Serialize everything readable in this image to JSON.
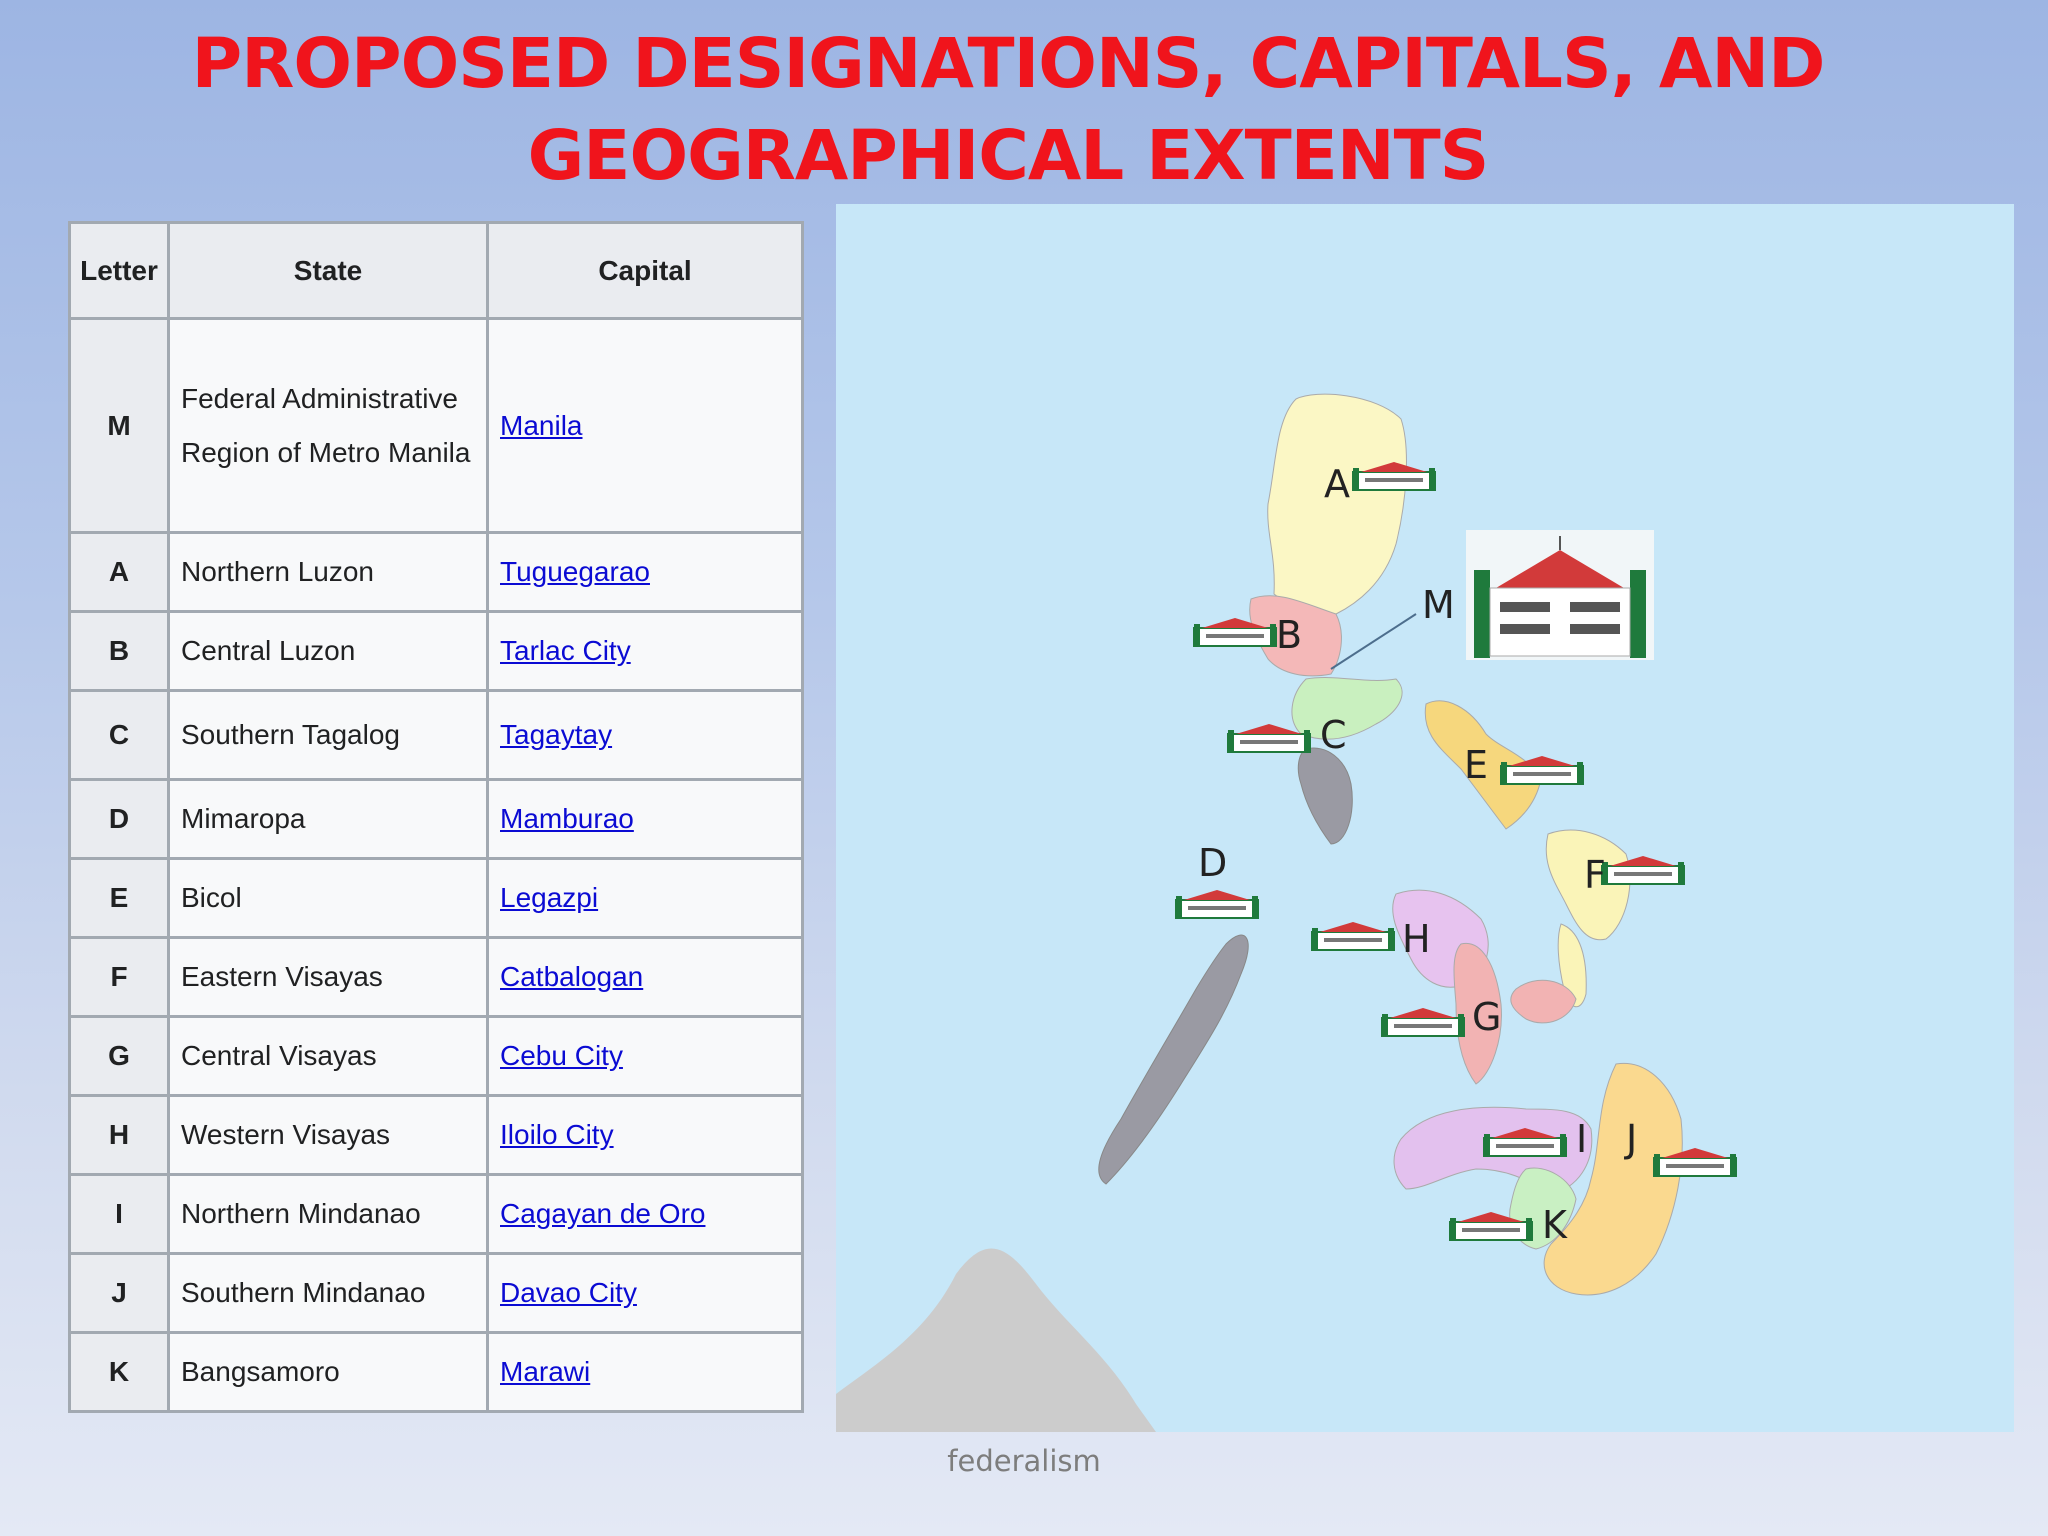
{
  "title": {
    "line1": "PROPOSED DESIGNATIONS, CAPITALS, AND",
    "line2": "GEOGRAPHICAL EXTENTS"
  },
  "table": {
    "headers": [
      "Letter",
      "State",
      "Capital"
    ],
    "rows": [
      {
        "letter": "M",
        "state": "Federal Administrative Region of Metro Manila",
        "capital": "Manila"
      },
      {
        "letter": "A",
        "state": "Northern Luzon",
        "capital": "Tuguegarao"
      },
      {
        "letter": "B",
        "state": "Central Luzon",
        "capital": "Tarlac City"
      },
      {
        "letter": "C",
        "state": "Southern Tagalog",
        "capital": "Tagaytay"
      },
      {
        "letter": "D",
        "state": "Mimaropa",
        "capital": "Mamburao"
      },
      {
        "letter": "E",
        "state": "Bicol",
        "capital": "Legazpi"
      },
      {
        "letter": "F",
        "state": "Eastern Visayas",
        "capital": "Catbalogan"
      },
      {
        "letter": "G",
        "state": "Central Visayas",
        "capital": "Cebu City"
      },
      {
        "letter": "H",
        "state": "Western Visayas",
        "capital": "Iloilo City"
      },
      {
        "letter": "I",
        "state": "Northern Mindanao",
        "capital": "Cagayan de Oro"
      },
      {
        "letter": "J",
        "state": "Southern Mindanao",
        "capital": "Davao City"
      },
      {
        "letter": "K",
        "state": "Bangsamoro",
        "capital": "Marawi"
      }
    ]
  },
  "map": {
    "labels": {
      "A": "A",
      "B": "B",
      "C": "C",
      "D": "D",
      "E": "E",
      "F": "F",
      "G": "G",
      "H": "H",
      "I": "I",
      "J": "J",
      "K": "K",
      "M": "M"
    },
    "colors": {
      "sea": "#c7e7f8",
      "north_luzon": "#fbf7c5",
      "central_luzon": "#f4b8b8",
      "southern_tagalog": "#c9f0bf",
      "mimaropa": "#9a9aa3",
      "bicol": "#f6d77d",
      "eastern_visayas": "#faf4b8",
      "central_visayas": "#f2b3b3",
      "western_visayas": "#e7c3ef",
      "northern_mindanao": "#e3c1ee",
      "southern_mindanao": "#fad98f",
      "bangsamoro": "#c9f0c3",
      "foreign_land": "#cccccc",
      "building_roof": "#d23a3a",
      "building_wall": "#ffffff",
      "building_trim": "#1f7a3c"
    },
    "icon": "capitol-building-icon"
  },
  "footer": "federalism"
}
